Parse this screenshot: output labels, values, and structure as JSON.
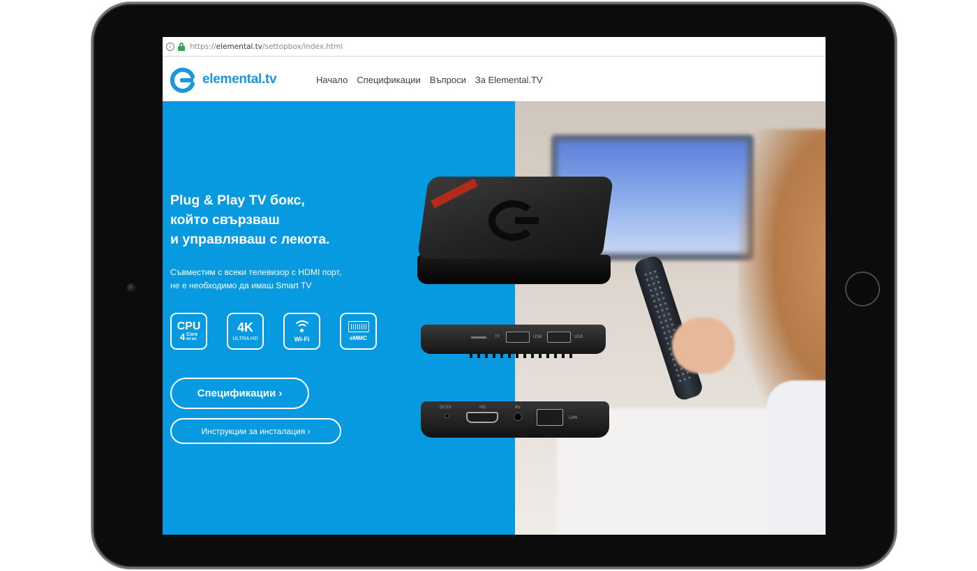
{
  "browser": {
    "url_scheme": "https://",
    "url_host": "elemental.tv",
    "url_path": "/settopbox/index.html",
    "info_icon": "i"
  },
  "header": {
    "logo_text": "elemental.tv",
    "nav": [
      "Начало",
      "Спецификации",
      "Въпроси",
      "За Elemental.TV"
    ]
  },
  "hero": {
    "title_lines": [
      "Plug & Play TV бокс,",
      "който свързваш",
      "и управляваш с лекота."
    ],
    "subtitle_lines": [
      "Съвместим с всеки телевизор с HDMI порт,",
      "не е необходимо да имаш Smart TV"
    ],
    "features": {
      "cpu": {
        "title": "CPU",
        "num": "4",
        "core": "Core",
        "bits": "64 bit"
      },
      "uhd": {
        "title": "4K",
        "sub": "ULTRA HD"
      },
      "wifi": {
        "sub": "Wi-Fi"
      },
      "emmc": {
        "sub": "eMMC"
      }
    },
    "primary_button": "Спецификации ›",
    "secondary_button": "Инструкции за инсталация ›"
  },
  "product_ports": {
    "tf": "TF",
    "usb1": "USB",
    "usb2": "USB",
    "dc": "DC5V",
    "hd": "HD",
    "av": "AV",
    "lan": "LAN"
  },
  "colors": {
    "brand_blue": "#079ae0",
    "logo_blue": "#1a97dd",
    "lock_green": "#2fa84f"
  }
}
